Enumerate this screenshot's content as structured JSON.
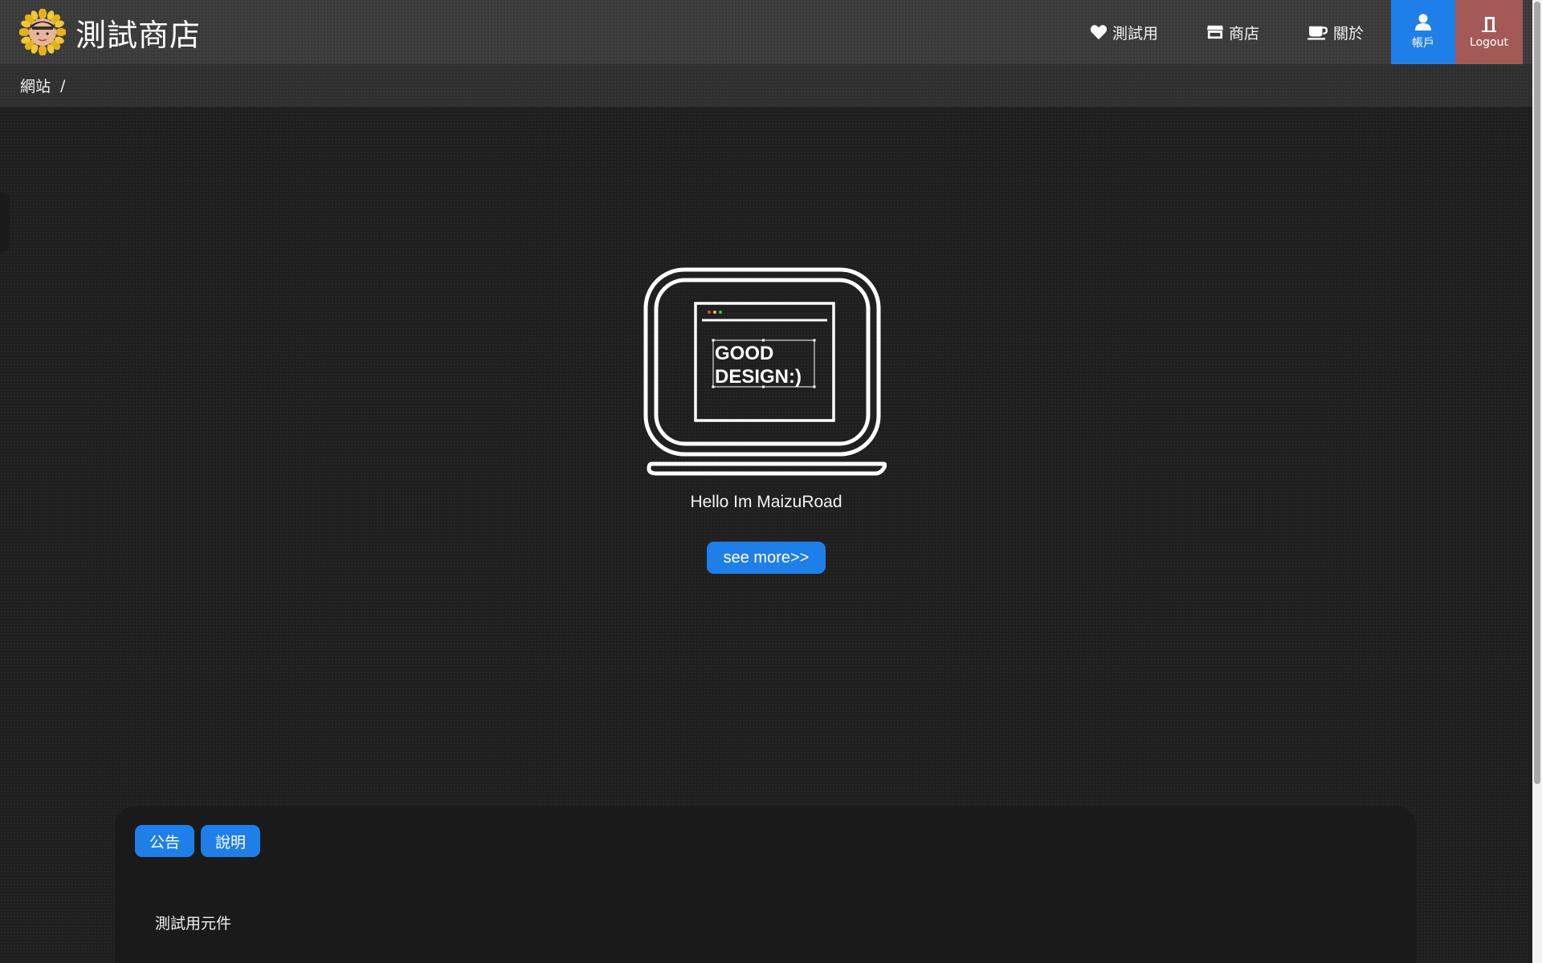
{
  "header": {
    "brand_title": "測試商店",
    "nav": [
      {
        "label": "測試用",
        "icon": "heart-icon"
      },
      {
        "label": "商店",
        "icon": "store-icon"
      },
      {
        "label": "關於",
        "icon": "coffee-icon"
      }
    ],
    "account_label": "帳戶",
    "logout_label": "Logout"
  },
  "breadcrumb": {
    "items": [
      "網站"
    ],
    "separator": "/"
  },
  "hero": {
    "screen_text_line1": "GOOD",
    "screen_text_line2": "DESIGN:)",
    "caption": "Hello Im MaizuRoad",
    "button_label": "see more>>"
  },
  "card": {
    "tabs": [
      "公告",
      "說明"
    ],
    "content": "測試用元件"
  },
  "colors": {
    "accent": "#1f7fe8",
    "logout": "#a35a57",
    "navbar": "#3a3a3b",
    "background": "#1f1f20"
  }
}
